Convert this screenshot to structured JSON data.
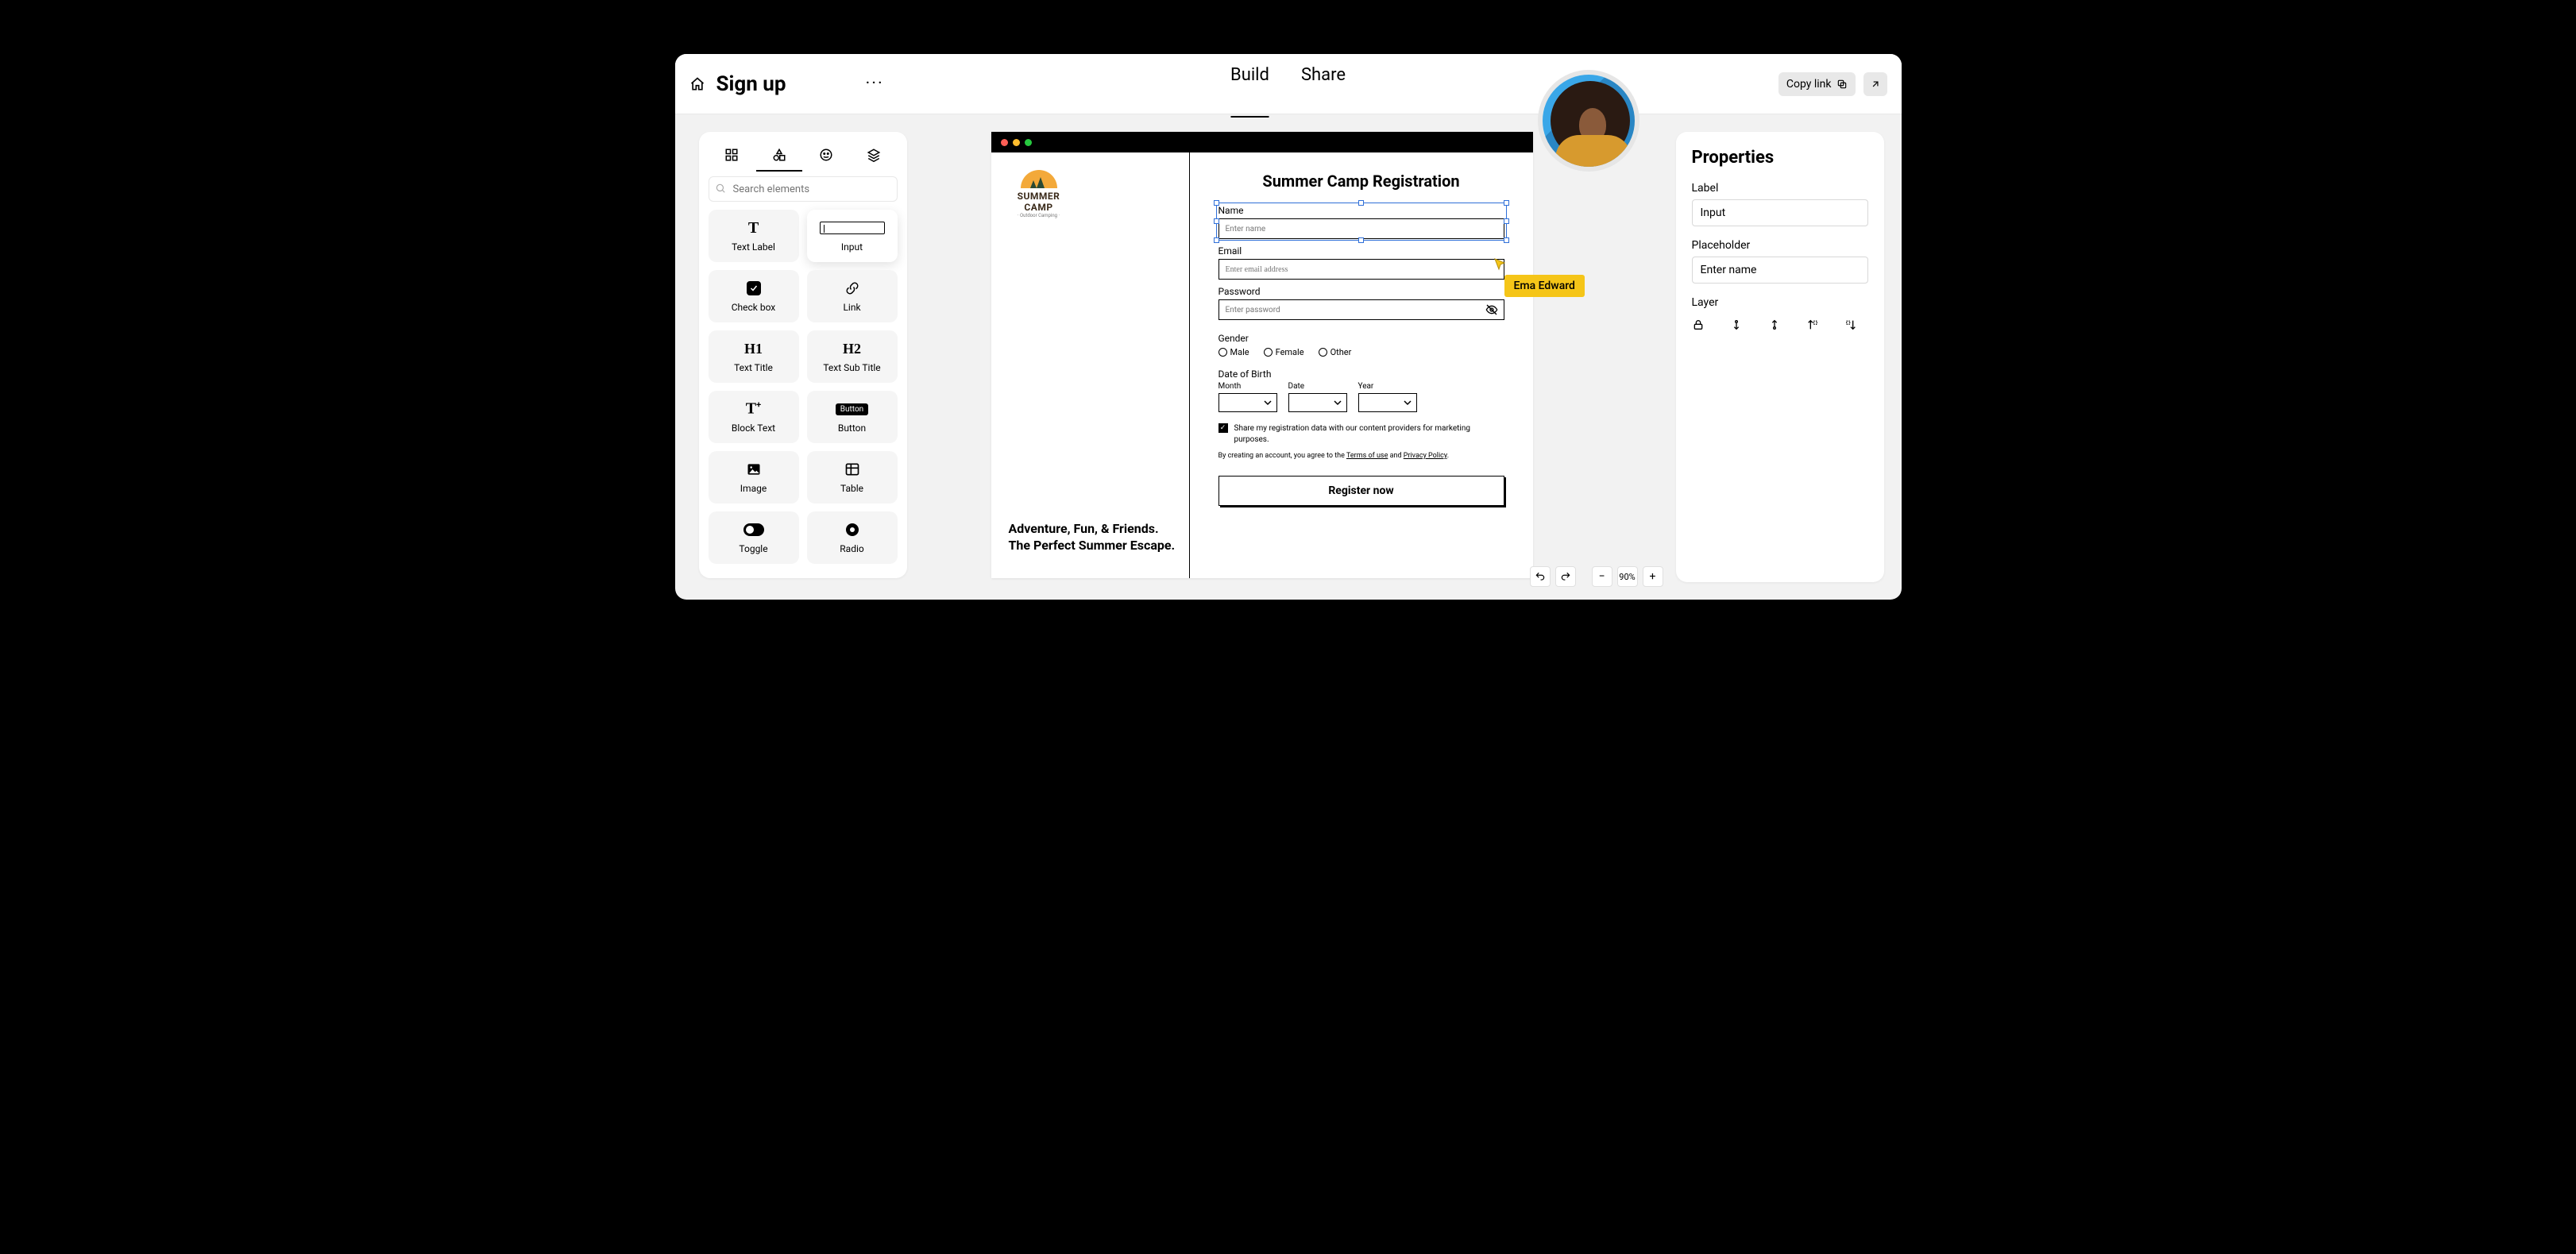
{
  "page_title": "Sign up",
  "tabs": {
    "build": "Build",
    "share": "Share",
    "active": "Build"
  },
  "topbar": {
    "copy_link": "Copy link"
  },
  "collaborator": {
    "name": "Ema Edward"
  },
  "elements_panel": {
    "search_placeholder": "Search elements",
    "tiles": {
      "text_label": "Text Label",
      "input": "Input",
      "checkbox": "Check box",
      "link": "Link",
      "h1": "Text Title",
      "h2": "Text Sub Title",
      "block_text": "Block Text",
      "button": "Button",
      "button_chip": "Button",
      "image": "Image",
      "table": "Table",
      "toggle": "Toggle",
      "radio": "Radio"
    }
  },
  "properties": {
    "heading": "Properties",
    "label_lbl": "Label",
    "label_val": "Input",
    "placeholder_lbl": "Placeholder",
    "placeholder_val": "Enter name",
    "layer_lbl": "Layer"
  },
  "canvas": {
    "logo_name": "SUMMER CAMP",
    "logo_sub": "· Outdoor Camping ·",
    "tagline1": "Adventure, Fun, & Friends.",
    "tagline2": "The Perfect Summer Escape.",
    "form": {
      "title": "Summer Camp Registration",
      "name_lbl": "Name",
      "name_ph": "Enter name",
      "email_lbl": "Email",
      "email_ph": "Enter email address",
      "password_lbl": "Password",
      "password_ph": "Enter password",
      "gender_lbl": "Gender",
      "gender": {
        "male": "Male",
        "female": "Female",
        "other": "Other"
      },
      "dob_lbl": "Date of Birth",
      "dob": {
        "month": "Month",
        "date": "Date",
        "year": "Year"
      },
      "consent": "Share my registration data with our content providers for marketing purposes.",
      "legal_pre": "By creating an account, you agree to the ",
      "legal_terms": "Terms of use",
      "legal_and": " and ",
      "legal_privacy": "Privacy Policy",
      "legal_dot": ".",
      "register": "Register now"
    }
  },
  "bottom_bar": {
    "zoom": "90%"
  }
}
